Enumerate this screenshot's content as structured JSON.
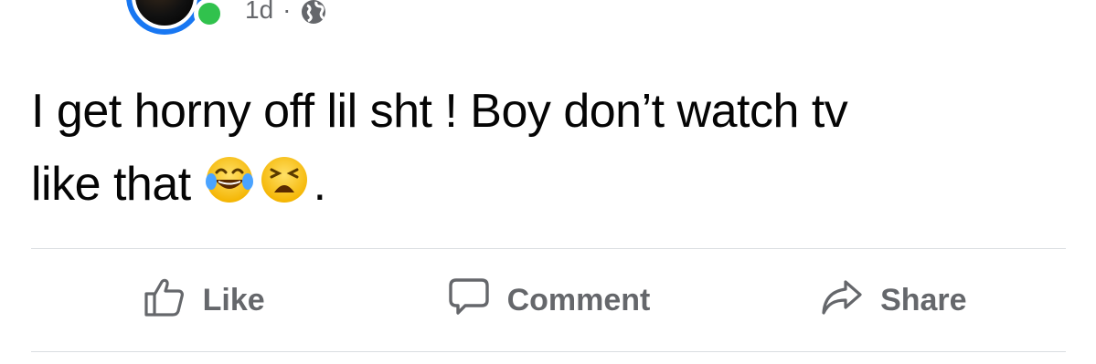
{
  "post": {
    "time": "1d",
    "separator": "·",
    "audience_icon": "globe-icon",
    "text_line1": "I get horny off lil sht ! Boy don’t watch tv",
    "text_line2": "like that",
    "text_end": ".",
    "emojis": [
      "face-with-tears-of-joy",
      "weary-face"
    ]
  },
  "actions": {
    "like_label": "Like",
    "comment_label": "Comment",
    "share_label": "Share"
  },
  "colors": {
    "accent": "#1877f2",
    "online": "#31c24d",
    "secondary_text": "#65676b",
    "primary_text": "#050505",
    "divider": "#dadde1"
  }
}
